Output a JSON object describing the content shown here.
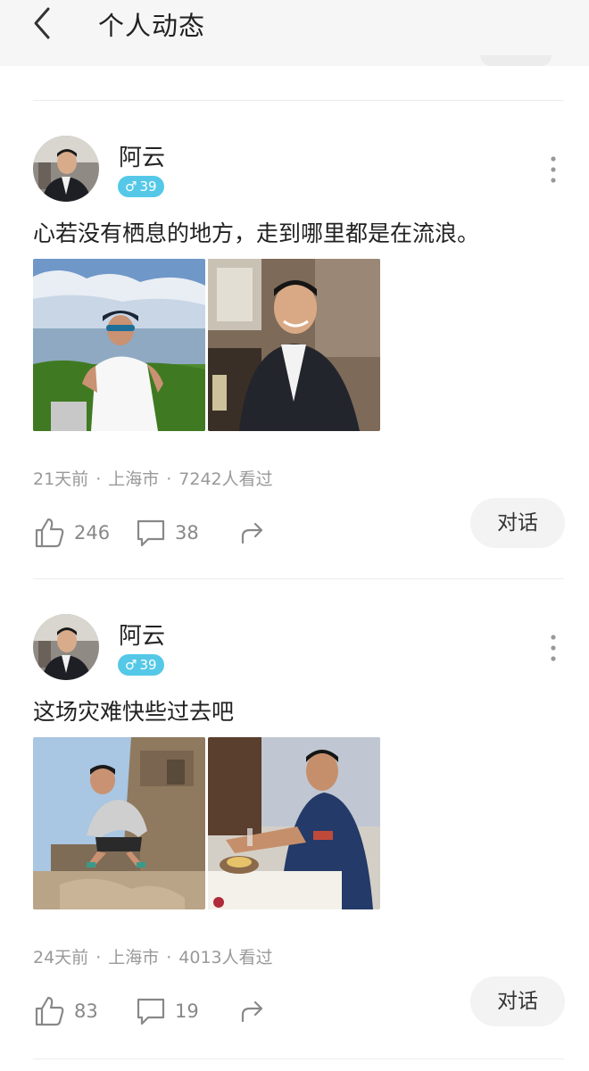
{
  "header": {
    "title": "个人动态",
    "back_icon": "chevron-left-icon"
  },
  "posts": [
    {
      "author": "阿云",
      "gender_symbol": "♂",
      "age": "39",
      "text": "心若没有栖息的地方，走到哪里都是在流浪。",
      "time": "21天前",
      "location": "上海市",
      "views": "7242人看过",
      "likes": "246",
      "comments": "38",
      "chat_label": "对话",
      "photos": [
        "seaside-photo",
        "restaurant-suit-photo"
      ]
    },
    {
      "author": "阿云",
      "gender_symbol": "♂",
      "age": "39",
      "text": "这场灾难快些过去吧",
      "time": "24天前",
      "location": "上海市",
      "views": "4013人看过",
      "likes": "83",
      "comments": "19",
      "chat_label": "对话",
      "photos": [
        "temple-ruins-photo",
        "dining-table-photo"
      ]
    }
  ],
  "meta_separator": "·",
  "colors": {
    "badge": "#55c8e8",
    "meta_text": "#999999",
    "header_bg": "#f6f6f6",
    "chat_bg": "#f3f3f3"
  }
}
